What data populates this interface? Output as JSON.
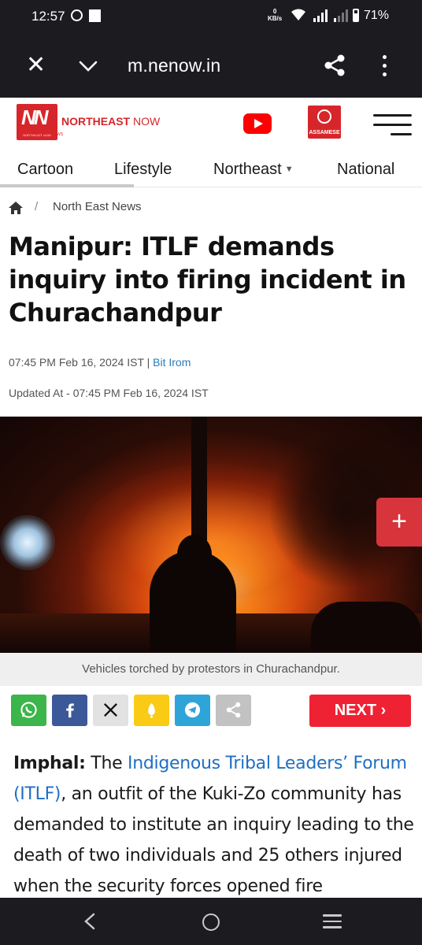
{
  "status": {
    "time": "12:57",
    "net_speed_value": "0",
    "net_speed_unit": "KB/s",
    "battery": "71%"
  },
  "browser": {
    "url": "m.nenow.in"
  },
  "site": {
    "logo_mark": "NN",
    "logo_small": "NORTHEAST NOW",
    "logo_tagline": "OUR LAND, OUR NEWS",
    "brand_bold": "NORTHEAST",
    "brand_light": " NOW",
    "assamese_label": "ASSAMESE"
  },
  "nav": {
    "items": [
      "Cartoon",
      "Lifestyle",
      "Northeast",
      "National"
    ]
  },
  "breadcrumb": {
    "separator": "/",
    "section": "North East News"
  },
  "article": {
    "title": "Manipur: ITLF demands inquiry into firing incident in Churachandpur",
    "published": "07:45 PM Feb 16, 2024 IST | ",
    "author": "Bit Irom",
    "updated": "Updated At - 07:45 PM Feb 16, 2024 IST",
    "caption": "Vehicles torched by protestors in Churachandpur.",
    "location": "Imphal:",
    "body_pre": " The ",
    "body_link": "Indigenous Tribal Leaders’ Forum (ITLF)",
    "body_post": ", an outfit of the Kuki-Zo community has demanded to institute an inquiry leading to the death of two individuals and 25 others injured when the security forces opened fire"
  },
  "actions": {
    "plus": "+",
    "next": "NEXT"
  },
  "share": {
    "buttons": [
      {
        "name": "whatsapp",
        "icon": "whatsapp-icon",
        "color": "#3cb54a"
      },
      {
        "name": "facebook",
        "icon": "facebook-icon",
        "color": "#3b5998"
      },
      {
        "name": "x",
        "icon": "x-icon",
        "color": "#e2e2e2"
      },
      {
        "name": "koo",
        "icon": "koo-icon",
        "color": "#f9cb14"
      },
      {
        "name": "telegram",
        "icon": "telegram-icon",
        "color": "#2fa4d9"
      },
      {
        "name": "share",
        "icon": "share-icon",
        "color": "#c2c2c2"
      }
    ]
  },
  "colors": {
    "brand_red": "#d7262b",
    "next_red": "#ee2233",
    "link_blue": "#1f6fc4"
  }
}
